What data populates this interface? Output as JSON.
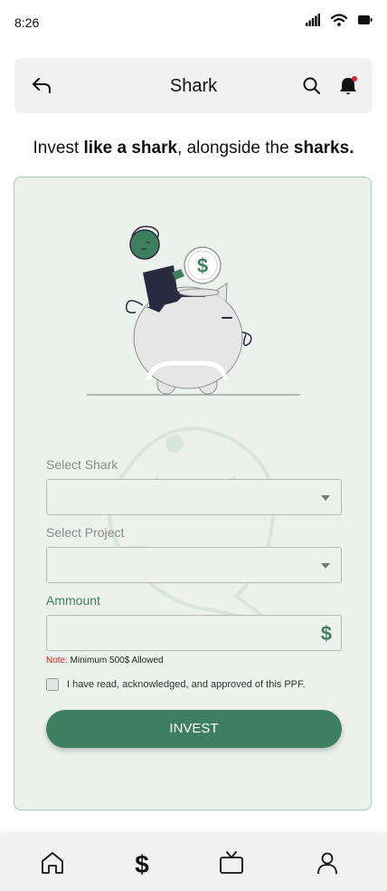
{
  "status_bar": {
    "time": "8:26",
    "icons": [
      "signal-icon",
      "wifi-icon",
      "battery-icon"
    ]
  },
  "header": {
    "title": "Shark",
    "icons": [
      "back-arrow-icon",
      "search-icon",
      "bell-icon"
    ],
    "has_notification_dot": true
  },
  "tagline": {
    "part1": "Invest ",
    "part2": "like a shark",
    "part3": ", alongside the ",
    "part4": "sharks."
  },
  "form": {
    "shark_label": "Select Shark",
    "shark_value": "",
    "project_label": "Select Project",
    "project_value": "",
    "amount_label": "Ammount",
    "amount_value": "",
    "amount_icon": "dollar-icon",
    "amount_currency_symbol": "$",
    "note_tag": "Note:",
    "note_text": " Minimum 500$ Allowed",
    "agreement_text": "I have read, acknowledged, and approved of this PPF.",
    "agreement_checked": false,
    "submit_label": "INVEST"
  },
  "bottom_nav": {
    "items": [
      "home-icon",
      "dollar-icon",
      "tv-icon",
      "profile-icon"
    ],
    "active": "dollar-icon"
  },
  "colors": {
    "accent": "#3d7f5f",
    "card_background": "#ecf1ee",
    "card_border": "#a8cdb5",
    "note_red": "#e02020",
    "notification_dot": "#e02020"
  }
}
